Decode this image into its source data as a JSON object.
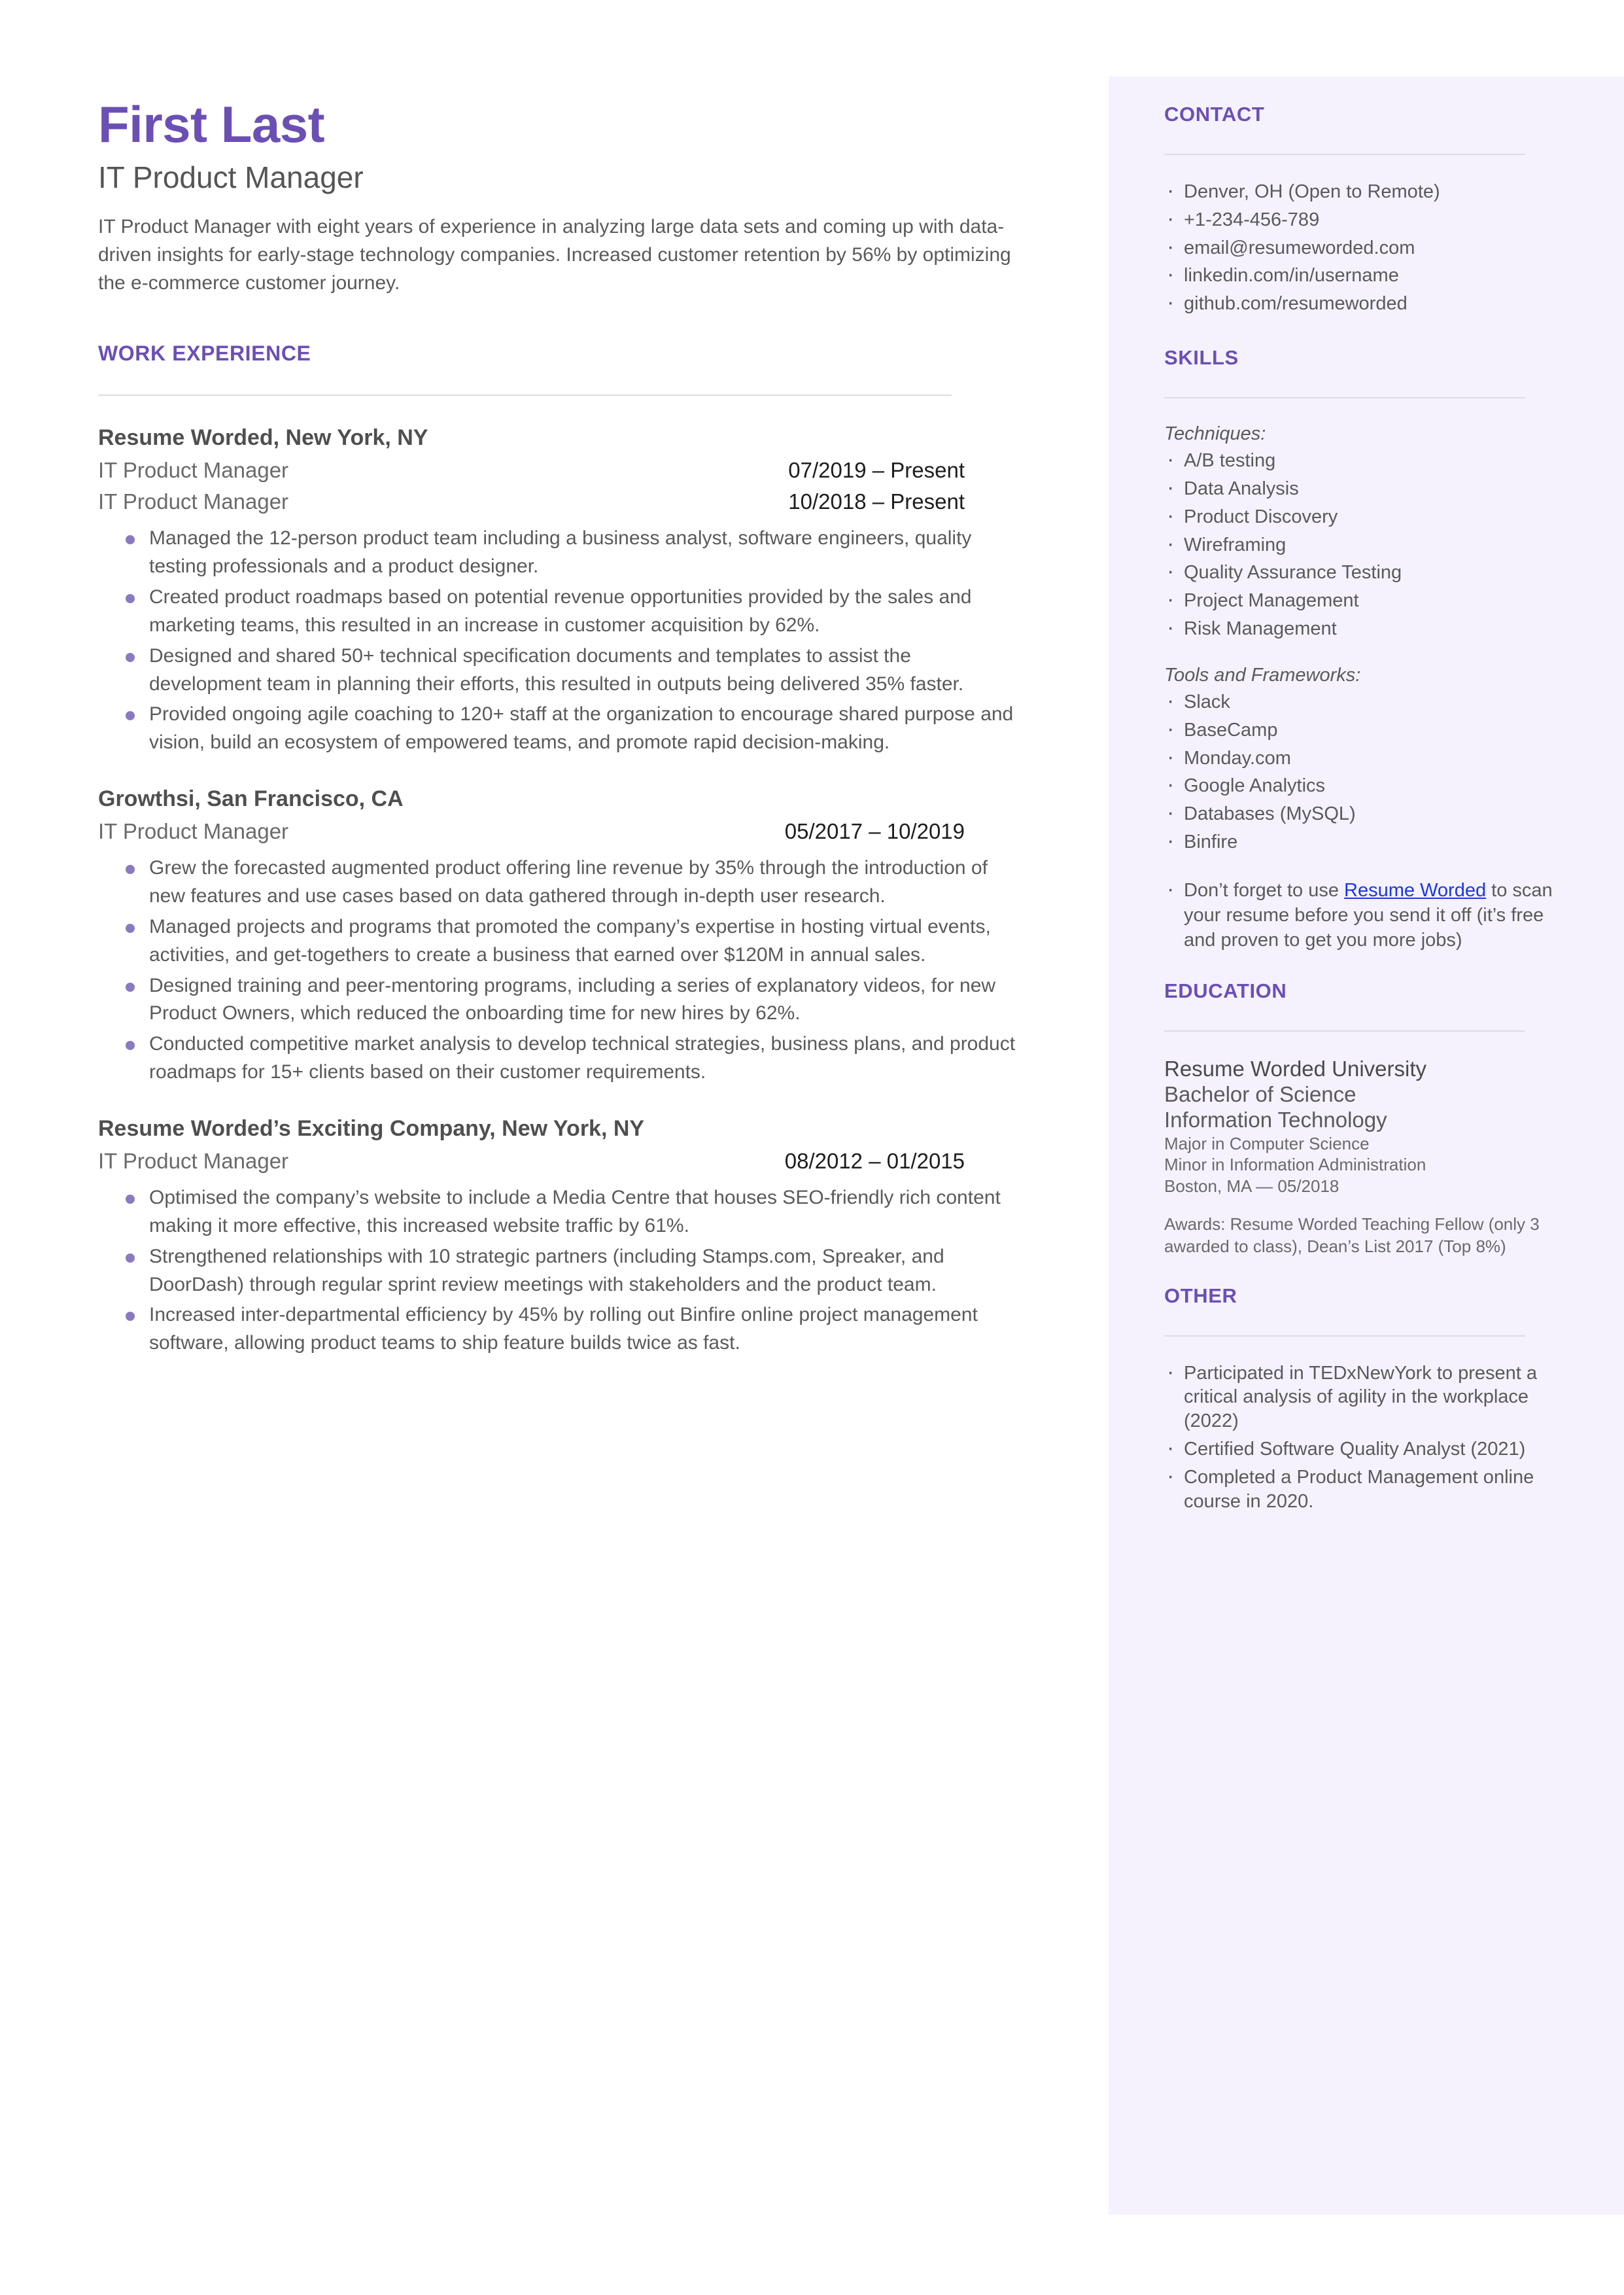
{
  "header": {
    "name": "First Last",
    "role": "IT Product Manager",
    "summary": "IT Product Manager with eight years of experience in analyzing large data sets and coming up with data-driven insights for early-stage technology companies. Increased customer retention by 56% by optimizing the e-commerce customer journey."
  },
  "work": {
    "heading": "WORK EXPERIENCE",
    "jobs": [
      {
        "company": "Resume Worded, New York, NY",
        "roles": [
          {
            "title": "IT Product Manager",
            "dates": "07/2019 – Present"
          },
          {
            "title": "IT Product Manager",
            "dates": "10/2018 – Present"
          }
        ],
        "bullets": [
          "Managed the 12-person product team including a business analyst, software engineers, quality testing professionals and a product designer.",
          "Created product roadmaps based on potential revenue opportunities provided by the sales and marketing teams, this resulted in an increase in customer acquisition by 62%.",
          "Designed and shared 50+ technical specification documents and templates to assist the development team in planning their efforts, this resulted in outputs being delivered 35% faster.",
          "Provided ongoing agile coaching to 120+ staff at the organization to encourage shared purpose and vision, build an ecosystem of empowered teams, and promote rapid decision-making."
        ]
      },
      {
        "company": "Growthsi, San Francisco, CA",
        "roles": [
          {
            "title": "IT Product Manager",
            "dates": "05/2017 – 10/2019"
          }
        ],
        "bullets": [
          "Grew the forecasted augmented product offering line revenue by 35% through the introduction of new features and use cases based on data gathered through in-depth user research.",
          "Managed projects and programs that promoted the company’s expertise in hosting virtual events, activities, and get-togethers to create a business that earned over $120M in annual sales.",
          "Designed training and peer-mentoring programs, including a series of explanatory videos, for new Product Owners, which reduced the onboarding time for new hires by 62%.",
          "Conducted competitive market analysis to develop technical strategies, business plans, and product roadmaps for 15+ clients based on their customer requirements."
        ]
      },
      {
        "company": "Resume Worded’s Exciting Company, New York, NY",
        "roles": [
          {
            "title": "IT Product Manager",
            "dates": "08/2012 – 01/2015"
          }
        ],
        "bullets": [
          "Optimised the company’s website to include a Media Centre that houses SEO-friendly rich content making it more effective, this increased website traffic by 61%.",
          "Strengthened relationships with 10 strategic partners (including Stamps.com, Spreaker, and DoorDash) through regular sprint review meetings with stakeholders and the product team.",
          "Increased inter-departmental efficiency by 45% by rolling out Binfire online project management software, allowing product teams to ship feature builds twice as fast."
        ]
      }
    ]
  },
  "sidebar": {
    "contact": {
      "heading": "CONTACT",
      "items": [
        "Denver, OH (Open to Remote)",
        "+1-234-456-789",
        "email@resumeworded.com",
        "linkedin.com/in/username",
        "github.com/resumeworded"
      ]
    },
    "skills": {
      "heading": "SKILLS",
      "groups": [
        {
          "label": "Techniques:",
          "items": [
            "A/B testing",
            "Data Analysis",
            "Product Discovery",
            "Wireframing",
            "Quality Assurance Testing",
            "Project Management",
            "Risk Management"
          ]
        },
        {
          "label": "Tools and Frameworks:",
          "items": [
            "Slack",
            "BaseCamp",
            "Monday.com",
            "Google Analytics",
            "Databases (MySQL)",
            "Binfire"
          ]
        }
      ],
      "promo": {
        "before": "Don’t forget to use ",
        "link": "Resume Worded",
        "after": " to scan your resume before you send it off (it’s free and proven to get you more jobs)"
      }
    },
    "education": {
      "heading": "EDUCATION",
      "school": "Resume Worded University",
      "degree_line1": "Bachelor of Science",
      "degree_line2": "Information Technology",
      "major": "Major in Computer Science",
      "minor": "Minor in Information Administration",
      "location_date": "Boston, MA — 05/2018",
      "awards": "Awards: Resume Worded Teaching Fellow (only 3 awarded to class), Dean’s List 2017 (Top 8%)"
    },
    "other": {
      "heading": "OTHER",
      "items": [
        "Participated in TEDxNewYork to present a critical analysis of agility in the workplace (2022)",
        "Certified Software Quality Analyst (2021)",
        "Completed a Product Management online course in 2020."
      ]
    }
  },
  "colors": {
    "accent_purple": "#6b4fb5",
    "sidebar_bg": "#f5f2fe",
    "link_blue": "#1a36e8",
    "bullet_purple": "#8a7ac0"
  }
}
